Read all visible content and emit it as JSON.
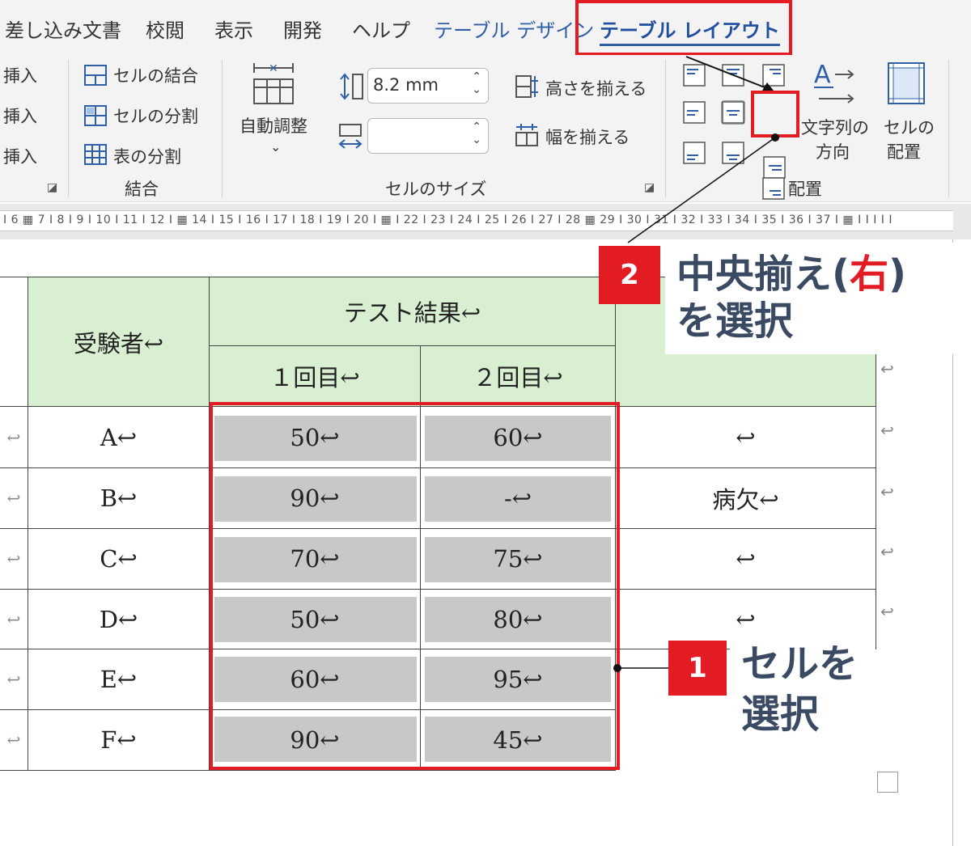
{
  "tabs": [
    {
      "label": "差し込み文書"
    },
    {
      "label": "校閲"
    },
    {
      "label": "表示"
    },
    {
      "label": "開発"
    },
    {
      "label": "ヘルプ"
    },
    {
      "label": "テーブル デザイン"
    },
    {
      "label": "テーブル レイアウト"
    }
  ],
  "ribbon": {
    "insert": [
      "挿入",
      "挿入",
      "挿入"
    ],
    "merge": {
      "merge_cells": "セルの結合",
      "split_cells": "セルの分割",
      "split_table": "表の分割",
      "group_label": "結合"
    },
    "cellsize": {
      "autofit_label": "自動調整",
      "height_value": "8.2 mm",
      "width_value": "",
      "distribute_rows": "高さを揃える",
      "distribute_cols": "幅を揃える",
      "group_label": "セルのサイズ"
    },
    "alignment": {
      "text_direction": [
        "文字列の",
        "方向"
      ],
      "cell_margins": [
        "セルの",
        "配置"
      ],
      "group_label": "配置"
    }
  },
  "ruler": {
    "text": "I 6 ▦ 7 I 8 I 9 I 10 I 11 I 12 I ▦ 14 I 15 I 16 I 17 I 18 I 19 I 20 I ▦ I 22 I 23 I 24 I 25 I 26 I 27 I 28 ▦ 29 I 30 I 31 I 32 I 33 I 34 I 35 I 36 I 37 I ▦ I I I I I"
  },
  "table": {
    "header_examinee": "受験者↩",
    "header_results": "テスト結果↩",
    "header_round1": "１回目↩",
    "header_round2": "２回目↩",
    "rows": [
      {
        "name": "A↩",
        "r1": "50↩",
        "r2": "60↩",
        "note": "↩"
      },
      {
        "name": "B↩",
        "r1": "90↩",
        "r2": "-↩",
        "note": "病欠↩"
      },
      {
        "name": "C↩",
        "r1": "70↩",
        "r2": "75↩",
        "note": "↩"
      },
      {
        "name": "D↩",
        "r1": "50↩",
        "r2": "80↩",
        "note": "↩"
      },
      {
        "name": "E↩",
        "r1": "60↩",
        "r2": "95↩",
        "note": ""
      },
      {
        "name": "F↩",
        "r1": "90↩",
        "r2": "45↩",
        "note": ""
      }
    ],
    "left_marks": [
      "↩",
      "↩",
      "↩",
      "↩",
      "↩",
      "↩"
    ],
    "right_marks": [
      "↩",
      "↩",
      "↩",
      "↩",
      "↩"
    ]
  },
  "callouts": {
    "step1_num": "1",
    "step1_line1": "セルを",
    "step1_line2": "選択",
    "step2_num": "2",
    "step2_line1_pre": "中央揃え(",
    "step2_line1_red": "右",
    "step2_line1_post": ")",
    "step2_line2": "を選択"
  },
  "colors": {
    "highlight": "#e31b23",
    "header_fill": "#d8f0d1",
    "selection_fill": "#c8c8c8",
    "accent_tab": "#2e5fa8"
  }
}
